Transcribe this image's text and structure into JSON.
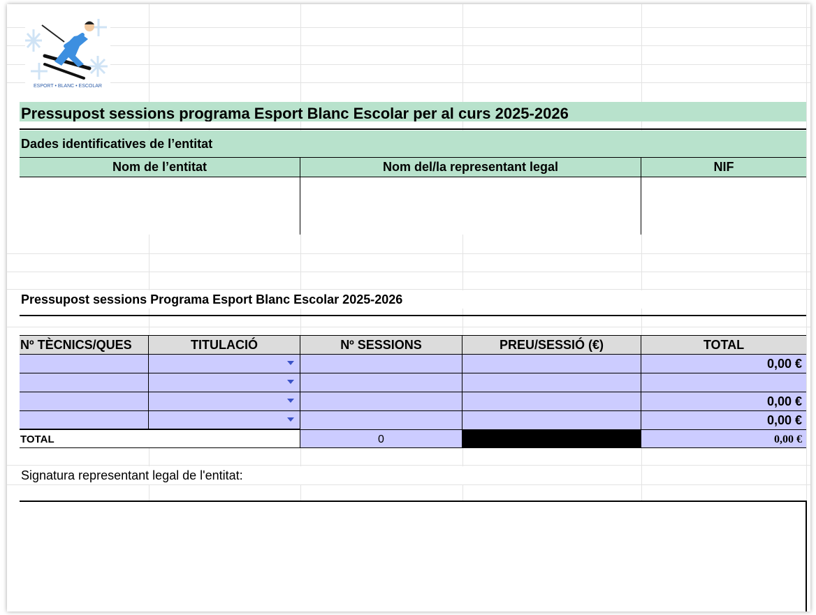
{
  "logo": {
    "caption": "ESPORT • BLANC • ESCOLAR"
  },
  "title": "Pressupost sessions programa Esport Blanc Escolar per al curs 2025-2026",
  "entity_section": {
    "heading": "Dades identificatives de l’entitat",
    "columns": [
      "Nom de l’entitat",
      "Nom del/la representant legal",
      "NIF"
    ],
    "values": [
      "",
      "",
      ""
    ]
  },
  "budget_section": {
    "heading": "Pressupost sessions Programa Esport Blanc Escolar 2025-2026",
    "columns": [
      "Nº TÈCNICS/QUES",
      "TITULACIÓ",
      "Nº SESSIONS",
      "PREU/SESSIÓ (€)",
      "TOTAL"
    ],
    "rows": [
      {
        "tecnics": "",
        "titulacio": "",
        "sessions": "",
        "preu": "",
        "total": "0,00 €"
      },
      {
        "tecnics": "",
        "titulacio": "",
        "sessions": "",
        "preu": "",
        "total": ""
      },
      {
        "tecnics": "",
        "titulacio": "",
        "sessions": "",
        "preu": "",
        "total": "0,00 €"
      },
      {
        "tecnics": "",
        "titulacio": "",
        "sessions": "",
        "preu": "",
        "total": "0,00 €"
      }
    ],
    "total_row": {
      "label": "TOTAL",
      "sessions": "0",
      "total": "0,00 €"
    }
  },
  "signature": {
    "label": "Signatura representant legal de l'entitat:"
  },
  "colors": {
    "header_green": "#b8e2cc",
    "input_lavender": "#ccccff",
    "header_gray": "#dcdcdc",
    "dropdown_arrow": "#3a52c7"
  }
}
